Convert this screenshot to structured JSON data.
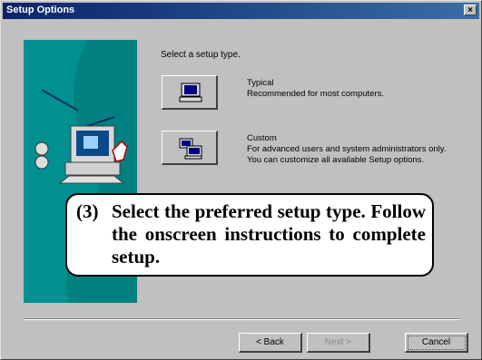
{
  "window": {
    "title": "Setup Options",
    "close_glyph": "×"
  },
  "prompt": "Select a setup type.",
  "options": [
    {
      "title": "Typical",
      "description": "Recommended for most computers.",
      "icon": "computer-icon"
    },
    {
      "title": "Custom",
      "description": "For advanced users and system administrators only. You can customize all available Setup options.",
      "icon": "network-computers-icon"
    }
  ],
  "callout": {
    "number": "(3)",
    "text": "Select the preferred setup type. Follow the onscreen instructions to complete setup."
  },
  "buttons": {
    "back": "< Back",
    "next": "Next >",
    "cancel": "Cancel"
  },
  "colors": {
    "titlebar_start": "#0a246a",
    "titlebar_end": "#3a6ea5",
    "panel": "#008080",
    "face": "#c0c0c0"
  }
}
